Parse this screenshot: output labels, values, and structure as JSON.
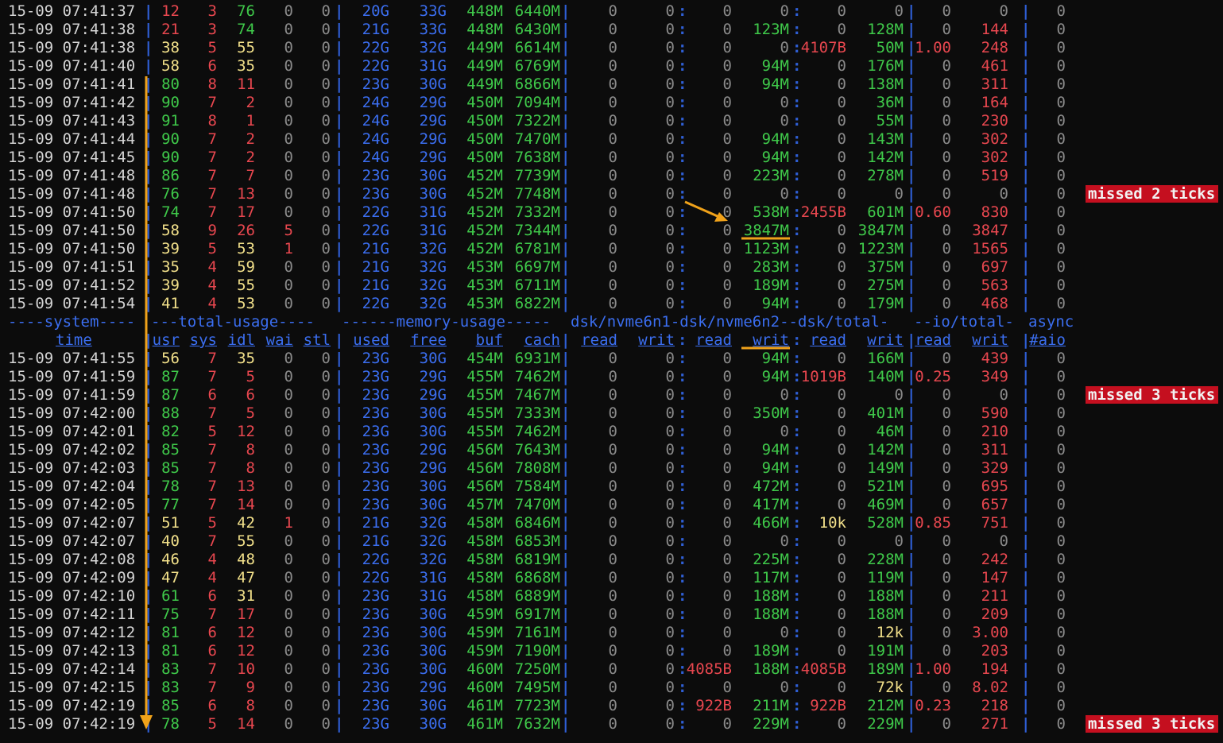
{
  "header": {
    "groups": [
      "----system----",
      "---total-usage----",
      "------memory-usage-----",
      "dsk/nvme6n1-dsk/nvme6n2--dsk/total-",
      "--io/total-",
      "async"
    ],
    "columns": [
      "time",
      "usr",
      "sys",
      "idl",
      "wai",
      "stl",
      "used",
      "free",
      "buf",
      "cach",
      "read",
      "writ",
      "read",
      "writ",
      "read",
      "writ",
      "read",
      "writ",
      "#aio"
    ]
  },
  "colors": {
    "white": "#d4d4d4",
    "green": "#3fc94a",
    "yellow": "#f2e08a",
    "red": "#e8474f",
    "blue": "#3b6ef0",
    "grey": "#8a8a8a",
    "gold": "#f0a21a"
  },
  "rows_top": [
    [
      "15-09 07:41:37",
      "12",
      "3",
      "76",
      "0",
      "0",
      "20G",
      "33G",
      "448M",
      "6440M",
      "0",
      "0",
      "0",
      "0",
      "0",
      "0",
      "0",
      "0",
      "0"
    ],
    [
      "15-09 07:41:38",
      "21",
      "3",
      "74",
      "0",
      "0",
      "21G",
      "33G",
      "448M",
      "6430M",
      "0",
      "0",
      "0",
      "123M",
      "0",
      "128M",
      "0",
      "144",
      "0"
    ],
    [
      "15-09 07:41:38",
      "38",
      "5",
      "55",
      "0",
      "0",
      "22G",
      "32G",
      "449M",
      "6614M",
      "0",
      "0",
      "0",
      "0",
      "4107B",
      "50M",
      "1.00",
      "248",
      "0"
    ],
    [
      "15-09 07:41:40",
      "58",
      "6",
      "35",
      "0",
      "0",
      "22G",
      "31G",
      "449M",
      "6769M",
      "0",
      "0",
      "0",
      "94M",
      "0",
      "176M",
      "0",
      "461",
      "0"
    ],
    [
      "15-09 07:41:41",
      "80",
      "8",
      "11",
      "0",
      "0",
      "23G",
      "30G",
      "449M",
      "6866M",
      "0",
      "0",
      "0",
      "94M",
      "0",
      "138M",
      "0",
      "311",
      "0"
    ],
    [
      "15-09 07:41:42",
      "90",
      "7",
      "2",
      "0",
      "0",
      "24G",
      "29G",
      "450M",
      "7094M",
      "0",
      "0",
      "0",
      "0",
      "0",
      "36M",
      "0",
      "164",
      "0"
    ],
    [
      "15-09 07:41:43",
      "91",
      "8",
      "1",
      "0",
      "0",
      "24G",
      "29G",
      "450M",
      "7322M",
      "0",
      "0",
      "0",
      "0",
      "0",
      "55M",
      "0",
      "230",
      "0"
    ],
    [
      "15-09 07:41:44",
      "90",
      "7",
      "2",
      "0",
      "0",
      "24G",
      "29G",
      "450M",
      "7470M",
      "0",
      "0",
      "0",
      "94M",
      "0",
      "143M",
      "0",
      "302",
      "0"
    ],
    [
      "15-09 07:41:45",
      "90",
      "7",
      "2",
      "0",
      "0",
      "24G",
      "29G",
      "450M",
      "7638M",
      "0",
      "0",
      "0",
      "94M",
      "0",
      "142M",
      "0",
      "302",
      "0"
    ],
    [
      "15-09 07:41:48",
      "86",
      "7",
      "7",
      "0",
      "0",
      "23G",
      "30G",
      "452M",
      "7739M",
      "0",
      "0",
      "0",
      "223M",
      "0",
      "278M",
      "0",
      "519",
      "0"
    ],
    [
      "15-09 07:41:48",
      "76",
      "7",
      "13",
      "0",
      "0",
      "23G",
      "30G",
      "452M",
      "7748M",
      "0",
      "0",
      "0",
      "0",
      "0",
      "0",
      "0",
      "0",
      "0"
    ],
    [
      "15-09 07:41:50",
      "74",
      "7",
      "17",
      "0",
      "0",
      "22G",
      "31G",
      "452M",
      "7332M",
      "0",
      "0",
      "0",
      "538M",
      "2455B",
      "601M",
      "0.60",
      "830",
      "0"
    ],
    [
      "15-09 07:41:50",
      "58",
      "9",
      "26",
      "5",
      "0",
      "22G",
      "31G",
      "452M",
      "7344M",
      "0",
      "0",
      "0",
      "3847M",
      "0",
      "3847M",
      "0",
      "3847",
      "0"
    ],
    [
      "15-09 07:41:50",
      "39",
      "5",
      "53",
      "1",
      "0",
      "21G",
      "32G",
      "452M",
      "6781M",
      "0",
      "0",
      "0",
      "1123M",
      "0",
      "1223M",
      "0",
      "1565",
      "0"
    ],
    [
      "15-09 07:41:51",
      "35",
      "4",
      "59",
      "0",
      "0",
      "21G",
      "32G",
      "453M",
      "6697M",
      "0",
      "0",
      "0",
      "283M",
      "0",
      "375M",
      "0",
      "697",
      "0"
    ],
    [
      "15-09 07:41:52",
      "39",
      "4",
      "55",
      "0",
      "0",
      "21G",
      "32G",
      "453M",
      "6711M",
      "0",
      "0",
      "0",
      "189M",
      "0",
      "275M",
      "0",
      "563",
      "0"
    ],
    [
      "15-09 07:41:54",
      "41",
      "4",
      "53",
      "0",
      "0",
      "22G",
      "32G",
      "453M",
      "6822M",
      "0",
      "0",
      "0",
      "94M",
      "0",
      "179M",
      "0",
      "468",
      "0"
    ]
  ],
  "rows_bottom": [
    [
      "15-09 07:41:55",
      "56",
      "7",
      "35",
      "0",
      "0",
      "23G",
      "30G",
      "454M",
      "6931M",
      "0",
      "0",
      "0",
      "94M",
      "0",
      "166M",
      "0",
      "439",
      "0"
    ],
    [
      "15-09 07:41:59",
      "87",
      "7",
      "5",
      "0",
      "0",
      "23G",
      "29G",
      "455M",
      "7462M",
      "0",
      "0",
      "0",
      "94M",
      "1019B",
      "140M",
      "0.25",
      "349",
      "0"
    ],
    [
      "15-09 07:41:59",
      "87",
      "6",
      "6",
      "0",
      "0",
      "23G",
      "29G",
      "455M",
      "7467M",
      "0",
      "0",
      "0",
      "0",
      "0",
      "0",
      "0",
      "0",
      "0"
    ],
    [
      "15-09 07:42:00",
      "88",
      "7",
      "5",
      "0",
      "0",
      "23G",
      "30G",
      "455M",
      "7333M",
      "0",
      "0",
      "0",
      "350M",
      "0",
      "401M",
      "0",
      "590",
      "0"
    ],
    [
      "15-09 07:42:01",
      "82",
      "5",
      "12",
      "0",
      "0",
      "23G",
      "30G",
      "455M",
      "7462M",
      "0",
      "0",
      "0",
      "0",
      "0",
      "46M",
      "0",
      "210",
      "0"
    ],
    [
      "15-09 07:42:02",
      "85",
      "7",
      "8",
      "0",
      "0",
      "23G",
      "29G",
      "456M",
      "7643M",
      "0",
      "0",
      "0",
      "94M",
      "0",
      "142M",
      "0",
      "311",
      "0"
    ],
    [
      "15-09 07:42:03",
      "85",
      "7",
      "8",
      "0",
      "0",
      "23G",
      "29G",
      "456M",
      "7808M",
      "0",
      "0",
      "0",
      "94M",
      "0",
      "149M",
      "0",
      "329",
      "0"
    ],
    [
      "15-09 07:42:04",
      "78",
      "7",
      "13",
      "0",
      "0",
      "23G",
      "30G",
      "456M",
      "7584M",
      "0",
      "0",
      "0",
      "472M",
      "0",
      "521M",
      "0",
      "695",
      "0"
    ],
    [
      "15-09 07:42:05",
      "77",
      "7",
      "14",
      "0",
      "0",
      "23G",
      "30G",
      "457M",
      "7470M",
      "0",
      "0",
      "0",
      "417M",
      "0",
      "469M",
      "0",
      "657",
      "0"
    ],
    [
      "15-09 07:42:07",
      "51",
      "5",
      "42",
      "1",
      "0",
      "21G",
      "32G",
      "458M",
      "6846M",
      "0",
      "0",
      "0",
      "466M",
      "10k",
      "528M",
      "0.85",
      "751",
      "0"
    ],
    [
      "15-09 07:42:07",
      "40",
      "7",
      "55",
      "0",
      "0",
      "21G",
      "32G",
      "458M",
      "6853M",
      "0",
      "0",
      "0",
      "0",
      "0",
      "0",
      "0",
      "0",
      "0"
    ],
    [
      "15-09 07:42:08",
      "46",
      "4",
      "48",
      "0",
      "0",
      "22G",
      "32G",
      "458M",
      "6819M",
      "0",
      "0",
      "0",
      "225M",
      "0",
      "228M",
      "0",
      "242",
      "0"
    ],
    [
      "15-09 07:42:09",
      "47",
      "4",
      "47",
      "0",
      "0",
      "22G",
      "31G",
      "458M",
      "6868M",
      "0",
      "0",
      "0",
      "117M",
      "0",
      "119M",
      "0",
      "147",
      "0"
    ],
    [
      "15-09 07:42:10",
      "61",
      "6",
      "31",
      "0",
      "0",
      "23G",
      "31G",
      "458M",
      "6889M",
      "0",
      "0",
      "0",
      "188M",
      "0",
      "188M",
      "0",
      "211",
      "0"
    ],
    [
      "15-09 07:42:11",
      "75",
      "7",
      "17",
      "0",
      "0",
      "23G",
      "30G",
      "459M",
      "6917M",
      "0",
      "0",
      "0",
      "188M",
      "0",
      "188M",
      "0",
      "209",
      "0"
    ],
    [
      "15-09 07:42:12",
      "81",
      "6",
      "12",
      "0",
      "0",
      "23G",
      "30G",
      "459M",
      "7161M",
      "0",
      "0",
      "0",
      "0",
      "0",
      "12k",
      "0",
      "3.00",
      "0"
    ],
    [
      "15-09 07:42:13",
      "81",
      "6",
      "12",
      "0",
      "0",
      "23G",
      "30G",
      "459M",
      "7190M",
      "0",
      "0",
      "0",
      "189M",
      "0",
      "191M",
      "0",
      "203",
      "0"
    ],
    [
      "15-09 07:42:14",
      "83",
      "7",
      "10",
      "0",
      "0",
      "23G",
      "30G",
      "460M",
      "7250M",
      "0",
      "0",
      "4085B",
      "188M",
      "4085B",
      "189M",
      "1.00",
      "194",
      "0"
    ],
    [
      "15-09 07:42:15",
      "83",
      "7",
      "9",
      "0",
      "0",
      "23G",
      "29G",
      "460M",
      "7495M",
      "0",
      "0",
      "0",
      "0",
      "0",
      "72k",
      "0",
      "8.02",
      "0"
    ],
    [
      "15-09 07:42:19",
      "85",
      "6",
      "8",
      "0",
      "0",
      "23G",
      "30G",
      "461M",
      "7723M",
      "0",
      "0",
      "922B",
      "211M",
      "922B",
      "212M",
      "0.23",
      "218",
      "0"
    ],
    [
      "15-09 07:42:19",
      "78",
      "5",
      "14",
      "0",
      "0",
      "23G",
      "30G",
      "461M",
      "7632M",
      "0",
      "0",
      "0",
      "229M",
      "0",
      "229M",
      "0",
      "271",
      "0"
    ]
  ],
  "badges": [
    {
      "label": "missed 2 ticks",
      "row": "top",
      "index": 10
    },
    {
      "label": "missed 3 ticks",
      "row": "bottom",
      "index": 2
    },
    {
      "label": "missed 3 ticks",
      "row": "bottom",
      "index": 20
    }
  ]
}
